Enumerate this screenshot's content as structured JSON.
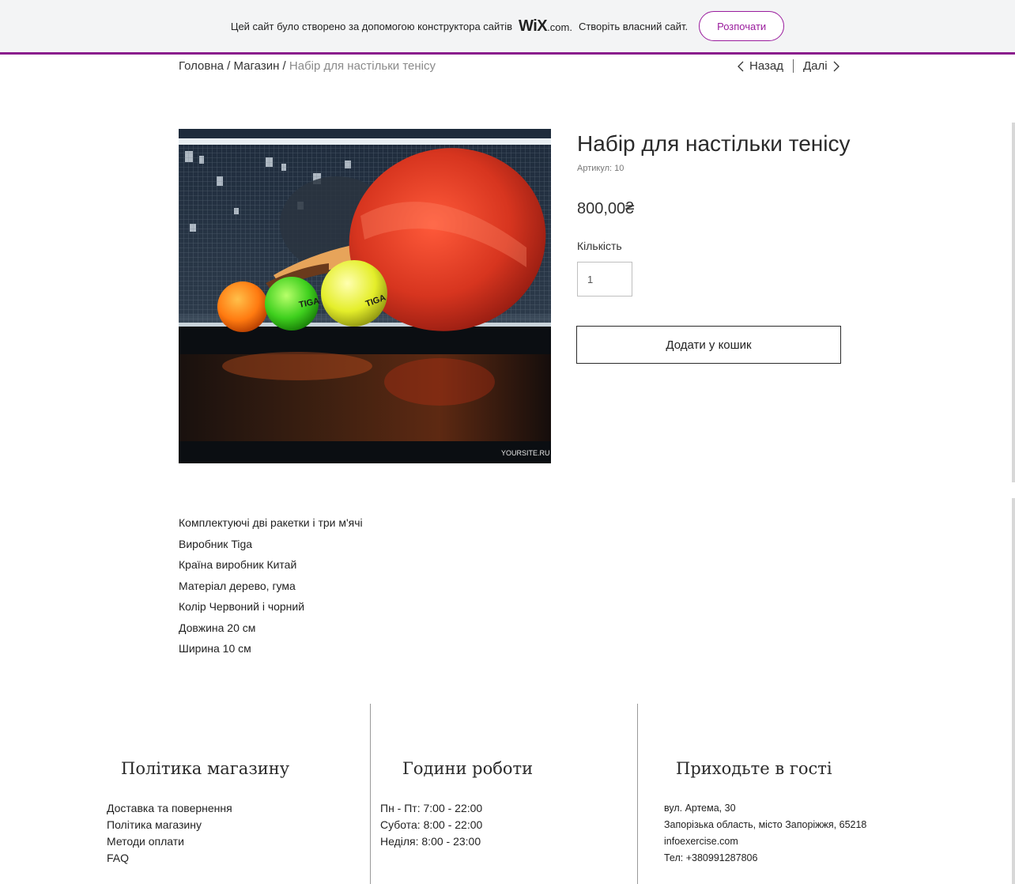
{
  "banner": {
    "text": "Цей сайт було створено за допомогою конструктора сайтів",
    "brand": "WiX",
    "brand_suffix": ".com.",
    "text2": "Створіть власний сайт.",
    "cta": "Розпочати"
  },
  "breadcrumb": {
    "home": "Головна",
    "sep1": " / ",
    "shop": "Магазин",
    "sep2": " / ",
    "current": "Набір для настільки тенісу"
  },
  "pager": {
    "back": "Назад",
    "next": "Далі"
  },
  "product": {
    "image_watermark": "YOURSITE.RU",
    "title": "Набір для настільки тенісу",
    "sku": "Артикул: 10",
    "price": "800,00₴",
    "quantity_label": "Кількість",
    "quantity_value": "1",
    "add_to_cart": "Додати у кошик"
  },
  "description": [
    "Комплектуючі дві ракетки і три м'ячі",
    "Виробник Tiga",
    "Країна виробник Китай",
    "Матеріал дерево, гума",
    "Колір Червоний і чорний",
    "Довжина 20 см",
    "Ширина 10 см"
  ],
  "footer": {
    "policy": {
      "title": "Політика магазину",
      "links": [
        "Доставка та повернення",
        "Політика магазину",
        "Методи оплати",
        "FAQ"
      ]
    },
    "hours": {
      "title": "Години роботи",
      "lines": [
        "Пн - Пт: 7:00 - 22:00",
        "Субота: 8:00 - 22:00",
        "Неділя: 8:00 - 23:00"
      ]
    },
    "visit": {
      "title": "Приходьте в гості",
      "lines": [
        "вул. Артема, 30",
        "Запорізька область, місто Запоріжжя, 65218",
        "infoexercise.com",
        "Тел: +380991287806"
      ]
    }
  },
  "colors": {
    "brand_purple": "#8a1d8d",
    "paddle_red": "#d7351f",
    "text": "#1c1c1c"
  }
}
